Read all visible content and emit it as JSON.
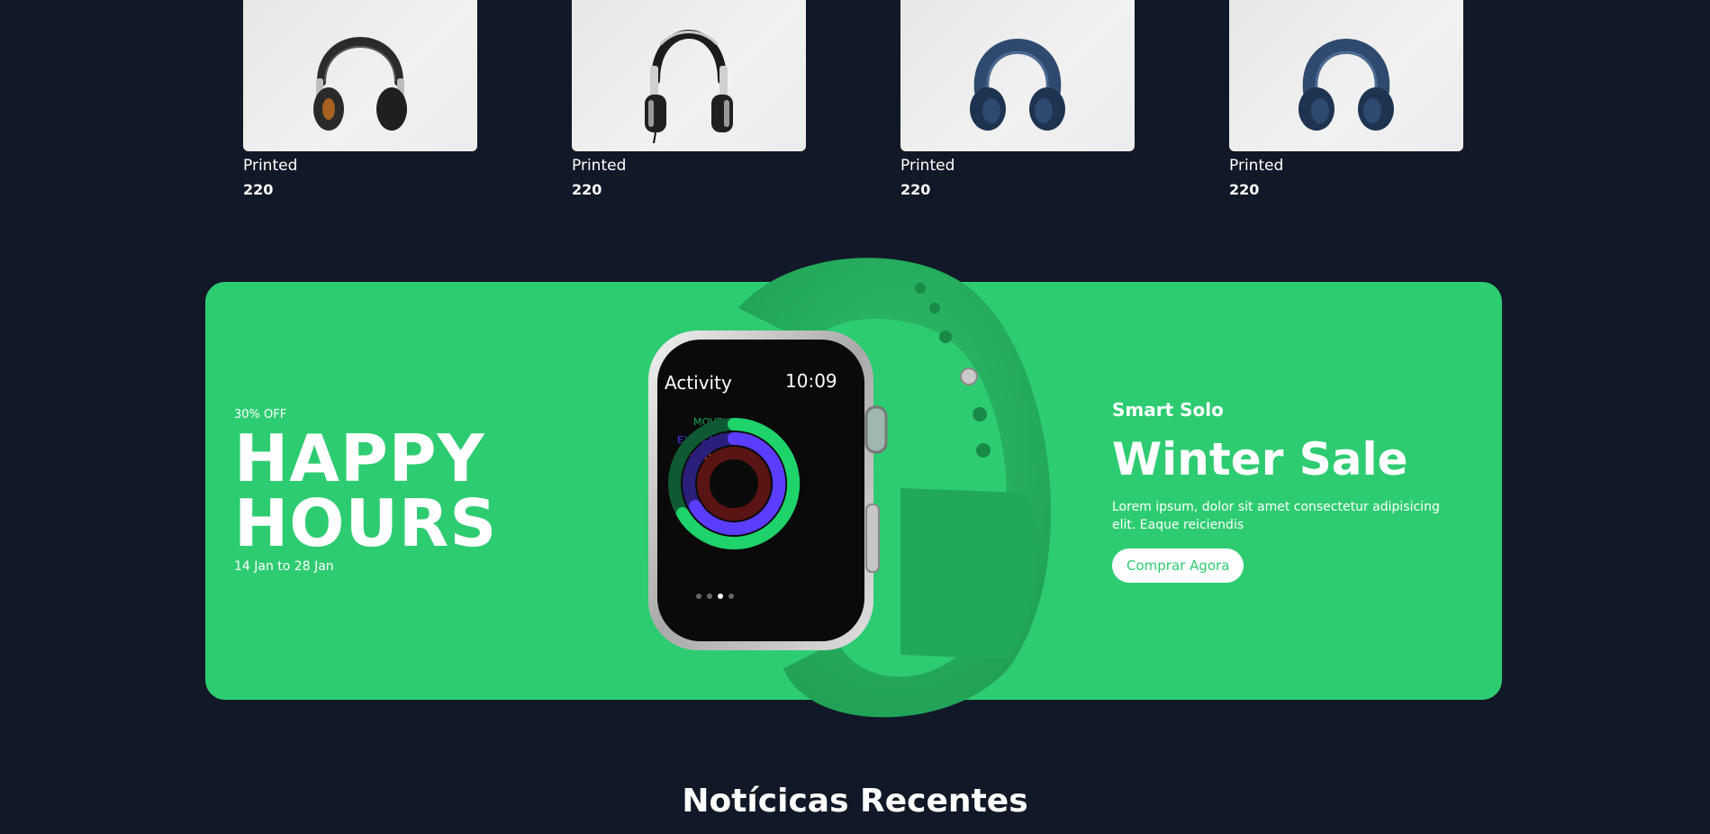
{
  "products": [
    {
      "name": "Printed",
      "price": "220",
      "icon": "headphones-black-icon"
    },
    {
      "name": "Printed",
      "price": "220",
      "icon": "headphones-silver-icon"
    },
    {
      "name": "Printed",
      "price": "220",
      "icon": "headphones-blue-icon"
    },
    {
      "name": "Printed",
      "price": "220",
      "icon": "headphones-blue-icon"
    }
  ],
  "banner": {
    "discount": "30% OFF",
    "headline_line1": "HAPPY",
    "headline_line2": "HOURS",
    "dates": "14 Jan to 28 Jan",
    "brand": "Smart Solo",
    "title": "Winter Sale",
    "description": "Lorem ipsum, dolor sit amet consectetur adipisicing elit. Eaque reiciendis",
    "button_label": "Comprar Agora",
    "watch": {
      "app": "Activity",
      "time": "10:09",
      "rings": [
        "MOVE",
        "EXERCISE",
        "STAND"
      ]
    },
    "colors": {
      "accent": "#2ecc71",
      "background": "#111827",
      "band": "#27ae60"
    }
  },
  "news": {
    "title": "Notícicas Recentes"
  }
}
